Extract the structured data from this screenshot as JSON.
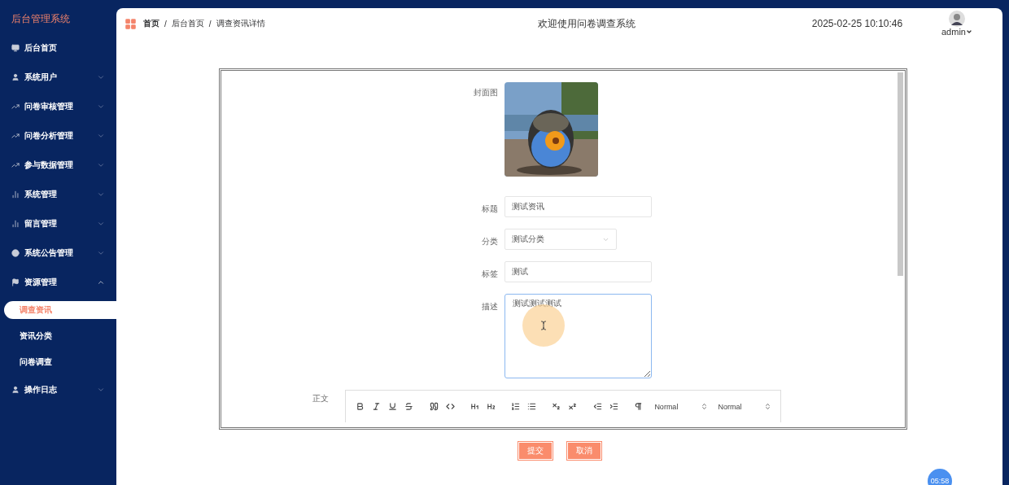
{
  "sidebar": {
    "title": "后台管理系统",
    "items": [
      {
        "kind": "link",
        "label": "后台首页"
      },
      {
        "kind": "group",
        "label": "系统用户",
        "expanded": false
      },
      {
        "kind": "group",
        "label": "问卷审核管理",
        "expanded": false
      },
      {
        "kind": "group",
        "label": "问卷分析管理",
        "expanded": false
      },
      {
        "kind": "group",
        "label": "参与数据管理",
        "expanded": false
      },
      {
        "kind": "group",
        "label": "系统管理",
        "expanded": false
      },
      {
        "kind": "group",
        "label": "留言管理",
        "expanded": false
      },
      {
        "kind": "group",
        "label": "系统公告管理",
        "expanded": false
      },
      {
        "kind": "group",
        "label": "资源管理",
        "expanded": true,
        "children": [
          {
            "label": "调查资讯",
            "selected": true
          },
          {
            "label": "资讯分类",
            "selected": false
          },
          {
            "label": "问卷调查",
            "selected": false
          }
        ]
      },
      {
        "kind": "group",
        "label": "操作日志",
        "expanded": false
      }
    ]
  },
  "header": {
    "breadcrumb": [
      "首页",
      "后台首页",
      "调查资讯详情"
    ],
    "separator": "/",
    "welcome": "欢迎使用问卷调查系统",
    "datetime": "2025-02-25 10:10:46",
    "user": "admin"
  },
  "form": {
    "fields": [
      {
        "label": "封面图"
      },
      {
        "kind": "input",
        "label": "标题",
        "value": "测试资讯"
      },
      {
        "kind": "select",
        "label": "分类",
        "value": "测试分类"
      },
      {
        "kind": "input",
        "label": "标签",
        "value": "测试"
      },
      {
        "kind": "textarea",
        "label": "描述",
        "value": "测试测试测试",
        "focused": true
      },
      {
        "kind": "editor",
        "label": "正文",
        "pickers": [
          "Normal",
          "Normal"
        ]
      }
    ]
  },
  "buttons": [
    "提交",
    "取消"
  ],
  "timer_badge": "05:58"
}
